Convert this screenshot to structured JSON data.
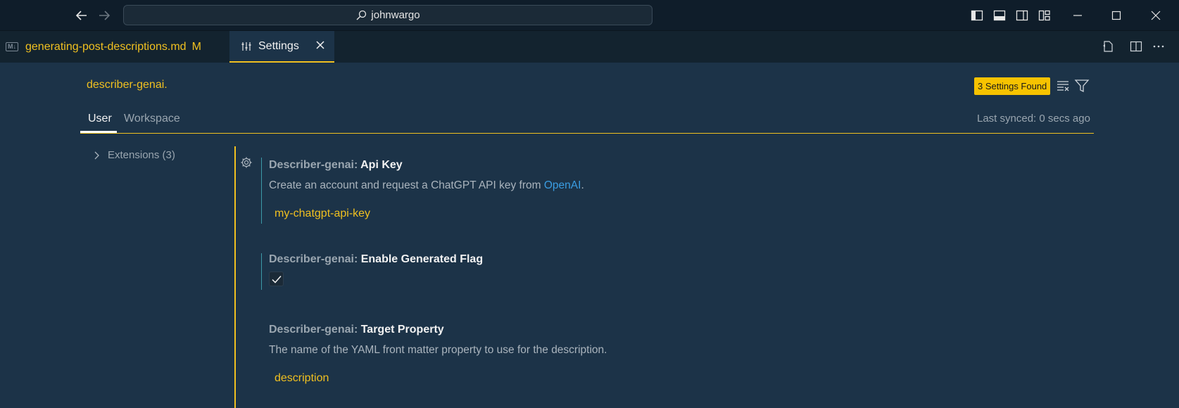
{
  "titlebar": {
    "search_text": "johnwargo",
    "icons": [
      "back-arrow-icon",
      "forward-arrow-icon",
      "toggle-primary-sidebar-icon",
      "toggle-panel-icon",
      "toggle-secondary-sidebar-icon",
      "customize-layout-icon",
      "minimize-icon",
      "maximize-icon",
      "close-icon"
    ]
  },
  "tabs": {
    "file_tab_label": "generating-post-descriptions.md",
    "file_tab_badge": "M",
    "file_tab_icon_text": "M↓",
    "settings_tab_label": "Settings"
  },
  "settings": {
    "search_query": "describer-genai.",
    "found_badge": "3 Settings Found",
    "scope_user": "User",
    "scope_workspace": "Workspace",
    "last_synced": "Last synced: 0 secs ago",
    "toc_item": "Extensions (3)",
    "items": [
      {
        "category": "Describer-genai: ",
        "name": "Api Key",
        "description_prefix": "Create an account and request a ChatGPT API key from ",
        "description_link": "OpenAI",
        "description_suffix": ".",
        "value": "my-chatgpt-api-key"
      },
      {
        "category": "Describer-genai: ",
        "name": "Enable Generated Flag",
        "checked": true
      },
      {
        "category": "Describer-genai: ",
        "name": "Target Property",
        "description": "The name of the YAML front matter property to use for the description.",
        "value": "description"
      }
    ]
  },
  "colors": {
    "accent": "#f0c020",
    "background": "#1c3348",
    "titlebar": "#0f1d2a",
    "link": "#3a9de2"
  }
}
